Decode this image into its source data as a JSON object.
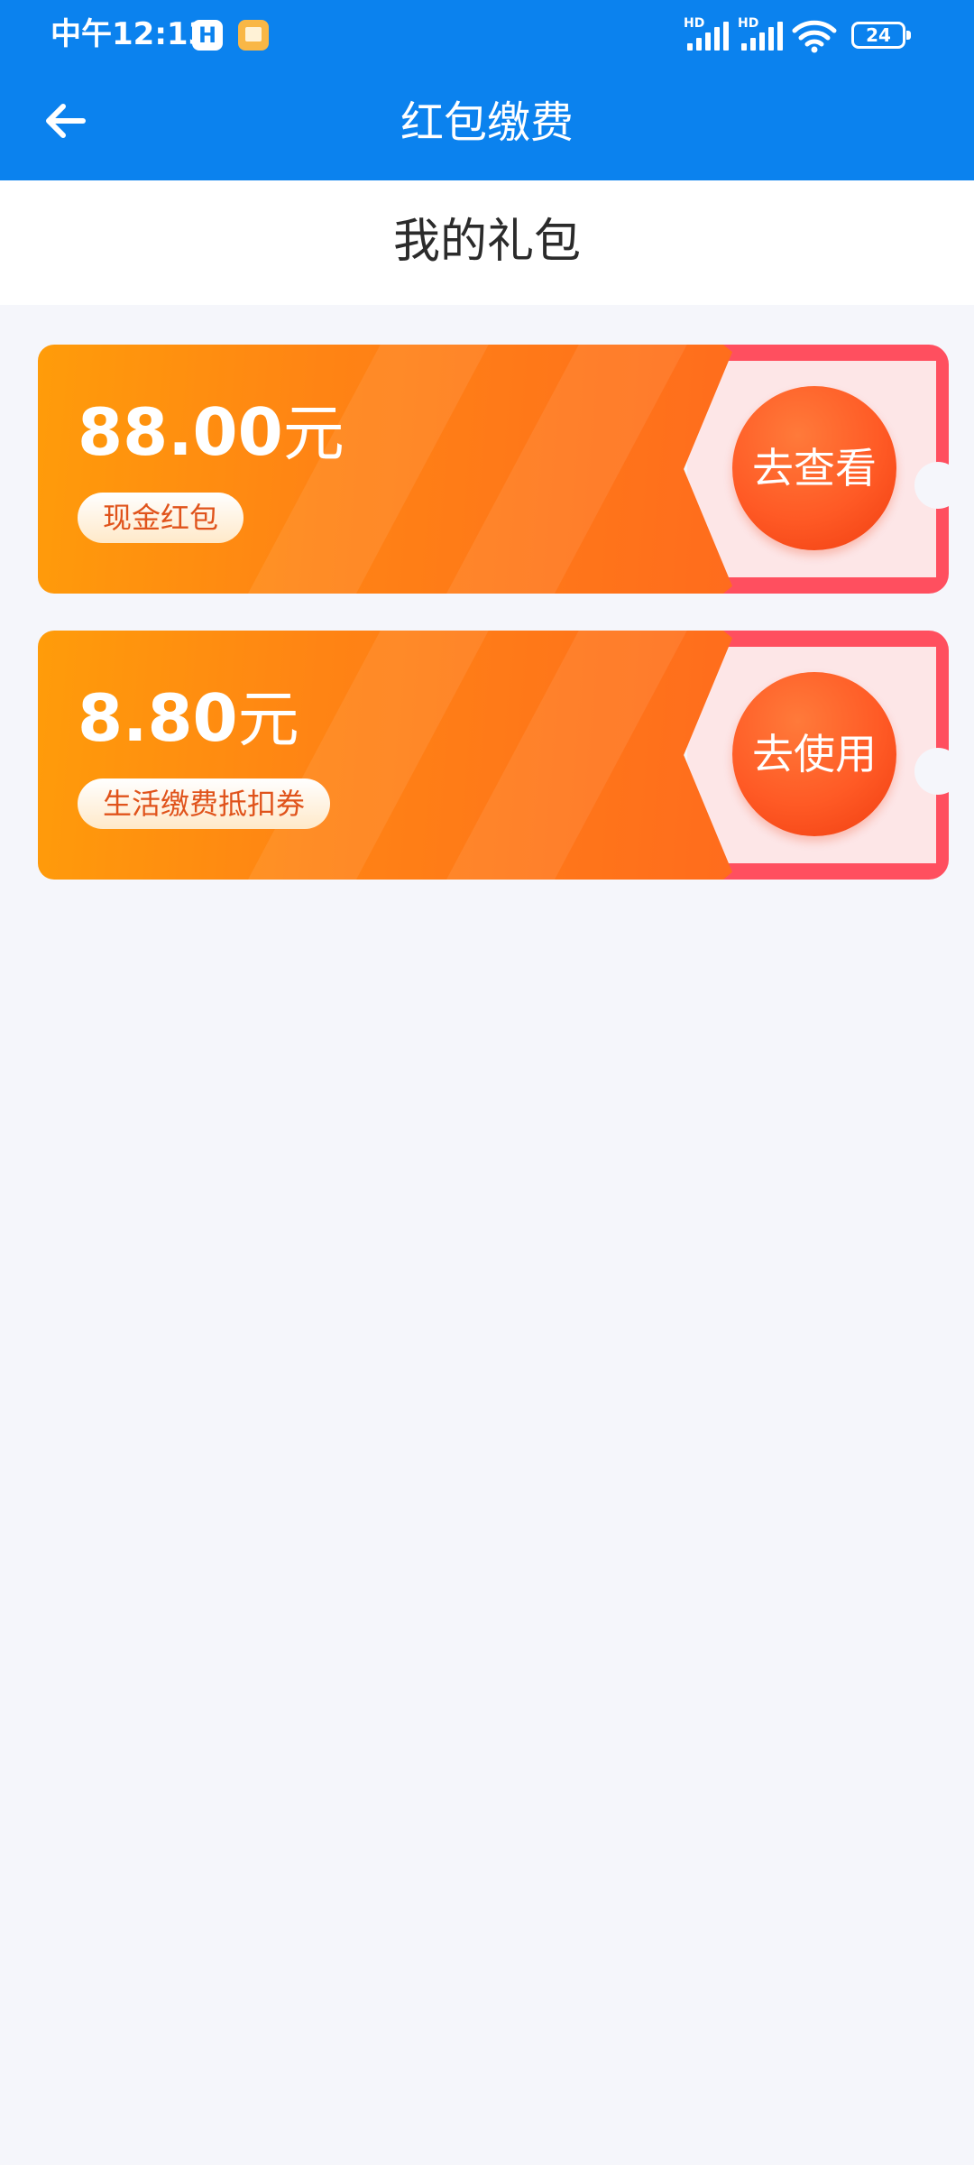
{
  "status_bar": {
    "time": "中午12:13",
    "app_icon_letter": "H",
    "signal_label": "HD",
    "battery": "24"
  },
  "nav": {
    "title": "红包缴费"
  },
  "section": {
    "title": "我的礼包"
  },
  "cards": [
    {
      "amount": "88.00",
      "unit": "元",
      "tag": "现金红包",
      "action": "去查看"
    },
    {
      "amount": "8.80",
      "unit": "元",
      "tag": "生活缴费抵扣券",
      "action": "去使用"
    }
  ],
  "colors": {
    "header": "#0b82ee",
    "page_bg": "#f5f6fb",
    "card_orange": "#ff8414",
    "card_red": "#ff4f5f",
    "stub_pink": "#fde6e7",
    "tag_text": "#e0531b"
  },
  "icons": {
    "back": "arrow-left-icon",
    "wifi": "wifi-icon",
    "battery": "battery-icon",
    "signal": "cellular-signal-icon"
  }
}
